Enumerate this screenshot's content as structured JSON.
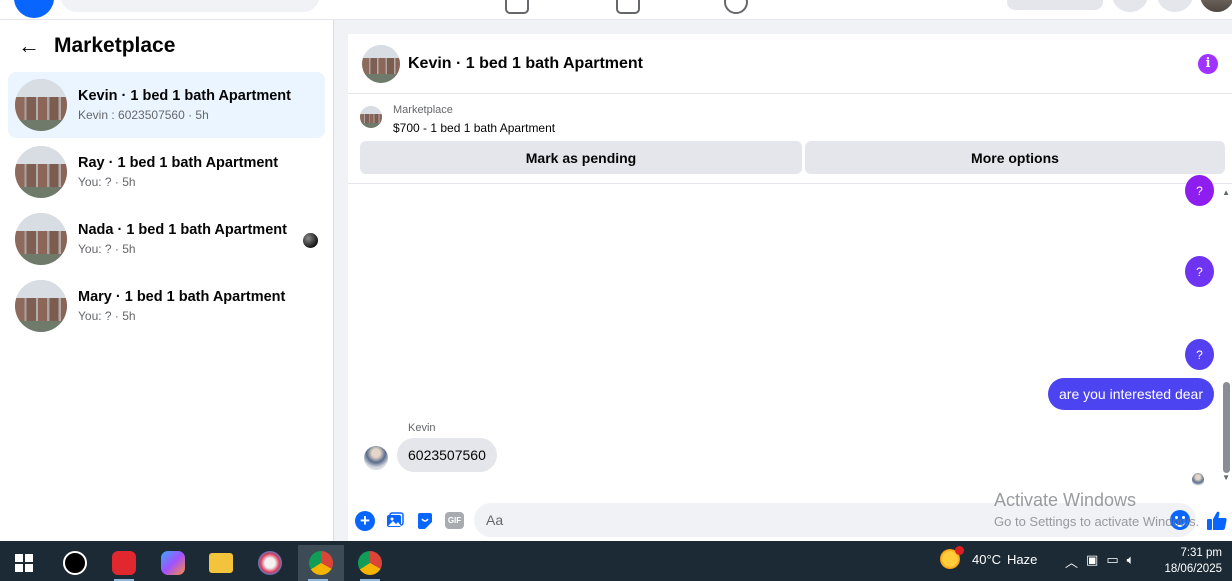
{
  "sidebar": {
    "title": "Marketplace",
    "conversations": [
      {
        "title": "Kevin · 1 bed 1 bath Apartment",
        "subtitle": "Kevin : 6023507560 · 5h"
      },
      {
        "title": "Ray · 1 bed 1 bath Apartment",
        "subtitle": "You: ? · 5h"
      },
      {
        "title": "Nada · 1 bed 1 bath Apartment",
        "subtitle": "You: ? · 5h"
      },
      {
        "title": "Mary · 1 bed 1 bath Apartment",
        "subtitle": "You: ? · 5h"
      }
    ]
  },
  "chat": {
    "header_title": "Kevin · 1 bed 1 bath Apartment",
    "info_glyph": "i",
    "listing": {
      "label": "Marketplace",
      "price_title": "$700 - 1 bed 1 bath Apartment",
      "mark_pending_label": "Mark as pending",
      "more_options_label": "More options"
    },
    "messages": {
      "q1": "?",
      "q2": "?",
      "q3": "?",
      "outgoing": "are you interested dear",
      "sender_name": "Kevin",
      "incoming": "6023507560"
    },
    "composer": {
      "placeholder": "Aa",
      "gif_label": "GIF"
    }
  },
  "watermark": {
    "title": "Activate Windows",
    "subtitle": "Go to Settings to activate Windows."
  },
  "taskbar": {
    "weather_temp": "40°C",
    "weather_text": "Haze",
    "time": "7:31 pm",
    "date": "18/06/2025"
  },
  "colors": {
    "accent_blue": "#0866ff",
    "active_conversation_bg": "#ebf5ff",
    "outgoing_bubble": "#4c44f0",
    "info_purple": "#a033ff"
  }
}
